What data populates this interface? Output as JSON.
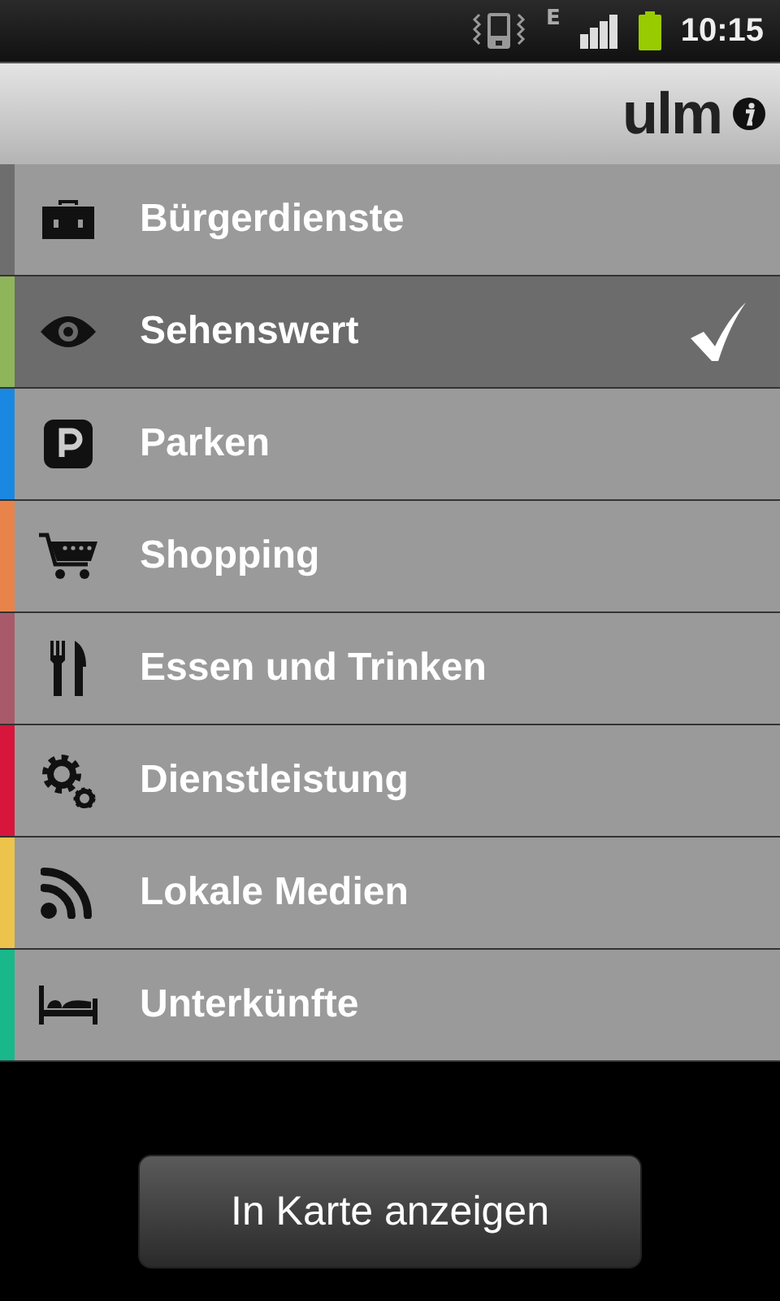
{
  "status_bar": {
    "network": "E",
    "time": "10:15"
  },
  "header": {
    "logo": "ulm"
  },
  "categories": [
    {
      "label": "Bürgerdienste",
      "kind": "briefcase",
      "color": "#6e6e6e",
      "selected": false
    },
    {
      "label": "Sehenswert",
      "kind": "eye",
      "color": "#8fb55a",
      "selected": true
    },
    {
      "label": "Parken",
      "kind": "parking",
      "color": "#1a88e0",
      "selected": false
    },
    {
      "label": "Shopping",
      "kind": "cart",
      "color": "#e8844a",
      "selected": false
    },
    {
      "label": "Essen und Trinken",
      "kind": "cutlery",
      "color": "#a85a6a",
      "selected": false
    },
    {
      "label": "Dienstleistung",
      "kind": "gears",
      "color": "#d8163c",
      "selected": false
    },
    {
      "label": "Lokale Medien",
      "kind": "rss",
      "color": "#ecc44c",
      "selected": false
    },
    {
      "label": "Unterkünfte",
      "kind": "bed",
      "color": "#18b88a",
      "selected": false
    }
  ],
  "button": "In Karte anzeigen"
}
